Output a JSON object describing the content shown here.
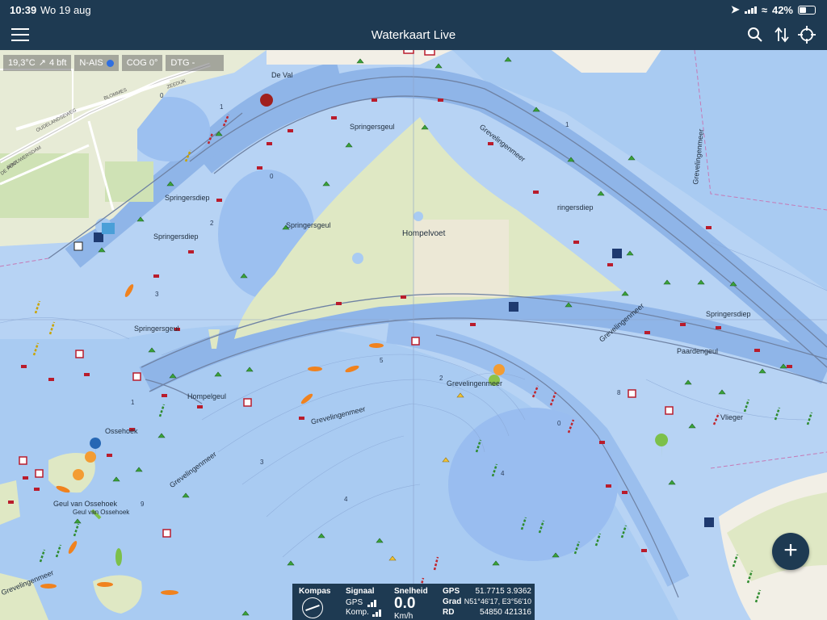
{
  "status": {
    "time": "10:39",
    "date": "Wo 19 aug",
    "battery": "42%"
  },
  "nav": {
    "title": "Waterkaart Live"
  },
  "info": {
    "temp": "19,3°C",
    "wind": "4 bft",
    "ais": "N-AIS",
    "cog": "COG 0°",
    "dtg": "DTG  -"
  },
  "map": {
    "labels": {
      "de_val": "De Val",
      "springersgeul_top": "Springersgeul",
      "springersdiep_left1": "Springersdiep",
      "springersdiep_left2": "Springersdiep",
      "springersgeul_mid": "Springersgeul",
      "hompelvoet": "Hompelvoet",
      "grevelingenmeer_top": "Grevelingenmeer",
      "springersdiep_right": "ringersdiep",
      "grevelingenmeer_far": "Grevelingenmeer",
      "springersgeul_low": "Springersgeul",
      "hompelgeul": "Hompelgeul",
      "grevelingenmeer_mid": "Grevelingenmeer",
      "grevelingenmeer_right": "Grevelingenmeer",
      "springersdiep_rr": "Springersdiep",
      "paardengeul": "Paardengeul",
      "vlieger": "Vlieger",
      "grevelingenmeer_c": "Grevelingenmeer",
      "ossehoek": "Ossehoek",
      "grevelingenmeer_l": "Grevelingenmeer",
      "geul_ossehoek": "Geul van Ossehoek",
      "geul_ossehoek2": "Geul van Ossehoek",
      "grevelingenmeer_bl": "Grevelingenmeer",
      "oudelandseweg": "OUDELANDSEWEG",
      "brouwersdam": "BROUWERSDAM",
      "de_punt": "DE PUNT",
      "zeedijk": "ZEEDIJK",
      "blommes": "BLOMMES"
    },
    "depths": [
      "1",
      "0",
      "2",
      "3",
      "5",
      "4",
      "1",
      "0",
      "2",
      "8",
      "3",
      "9",
      "0",
      "1",
      "4"
    ]
  },
  "panel": {
    "kompas": "Kompas",
    "signaal": "Signaal",
    "gps": "GPS",
    "komp": "Komp.",
    "snelheid": "Snelheid",
    "speed": "0.0",
    "unit": "Km/h",
    "gps_lbl": "GPS",
    "gps_val": "51.7715 3.9362",
    "grad_lbl": "Grad",
    "grad_val": "N51°46'17, E3°56'10",
    "rd_lbl": "RD",
    "rd_val": "54850 421316"
  },
  "fab": {
    "label": "+"
  }
}
